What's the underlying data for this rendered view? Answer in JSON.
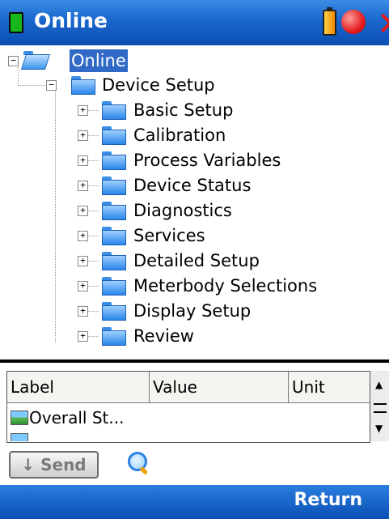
{
  "titlebar": {
    "title": "Online",
    "status_icon": "green-square-icon",
    "battery_icon": "battery-icon",
    "record_icon": "red-circle-icon",
    "close_icon": "close-icon"
  },
  "tree": {
    "root": {
      "label": "Online",
      "expander": "−"
    },
    "device_setup": {
      "label": "Device Setup",
      "expander": "−"
    },
    "children": [
      {
        "label": "Basic Setup",
        "expander": "+"
      },
      {
        "label": "Calibration",
        "expander": "+"
      },
      {
        "label": "Process Variables",
        "expander": "+"
      },
      {
        "label": "Device Status",
        "expander": "+"
      },
      {
        "label": "Diagnostics",
        "expander": "+"
      },
      {
        "label": "Services",
        "expander": "+"
      },
      {
        "label": "Detailed Setup",
        "expander": "+"
      },
      {
        "label": "Meterbody Selections",
        "expander": "+"
      },
      {
        "label": "Display Setup",
        "expander": "+"
      },
      {
        "label": "Review",
        "expander": "+"
      }
    ]
  },
  "grid": {
    "columns": [
      "Label",
      "Value",
      "Unit"
    ],
    "rows": [
      {
        "label": "Overall St...",
        "value": "",
        "unit": ""
      }
    ]
  },
  "toolbar": {
    "send_label": "↓ Send",
    "search_icon": "search-icon"
  },
  "bottombar": {
    "return_label": "Return"
  },
  "colors": {
    "title_bar": "#1a66cc",
    "selection": "#3169c6"
  }
}
